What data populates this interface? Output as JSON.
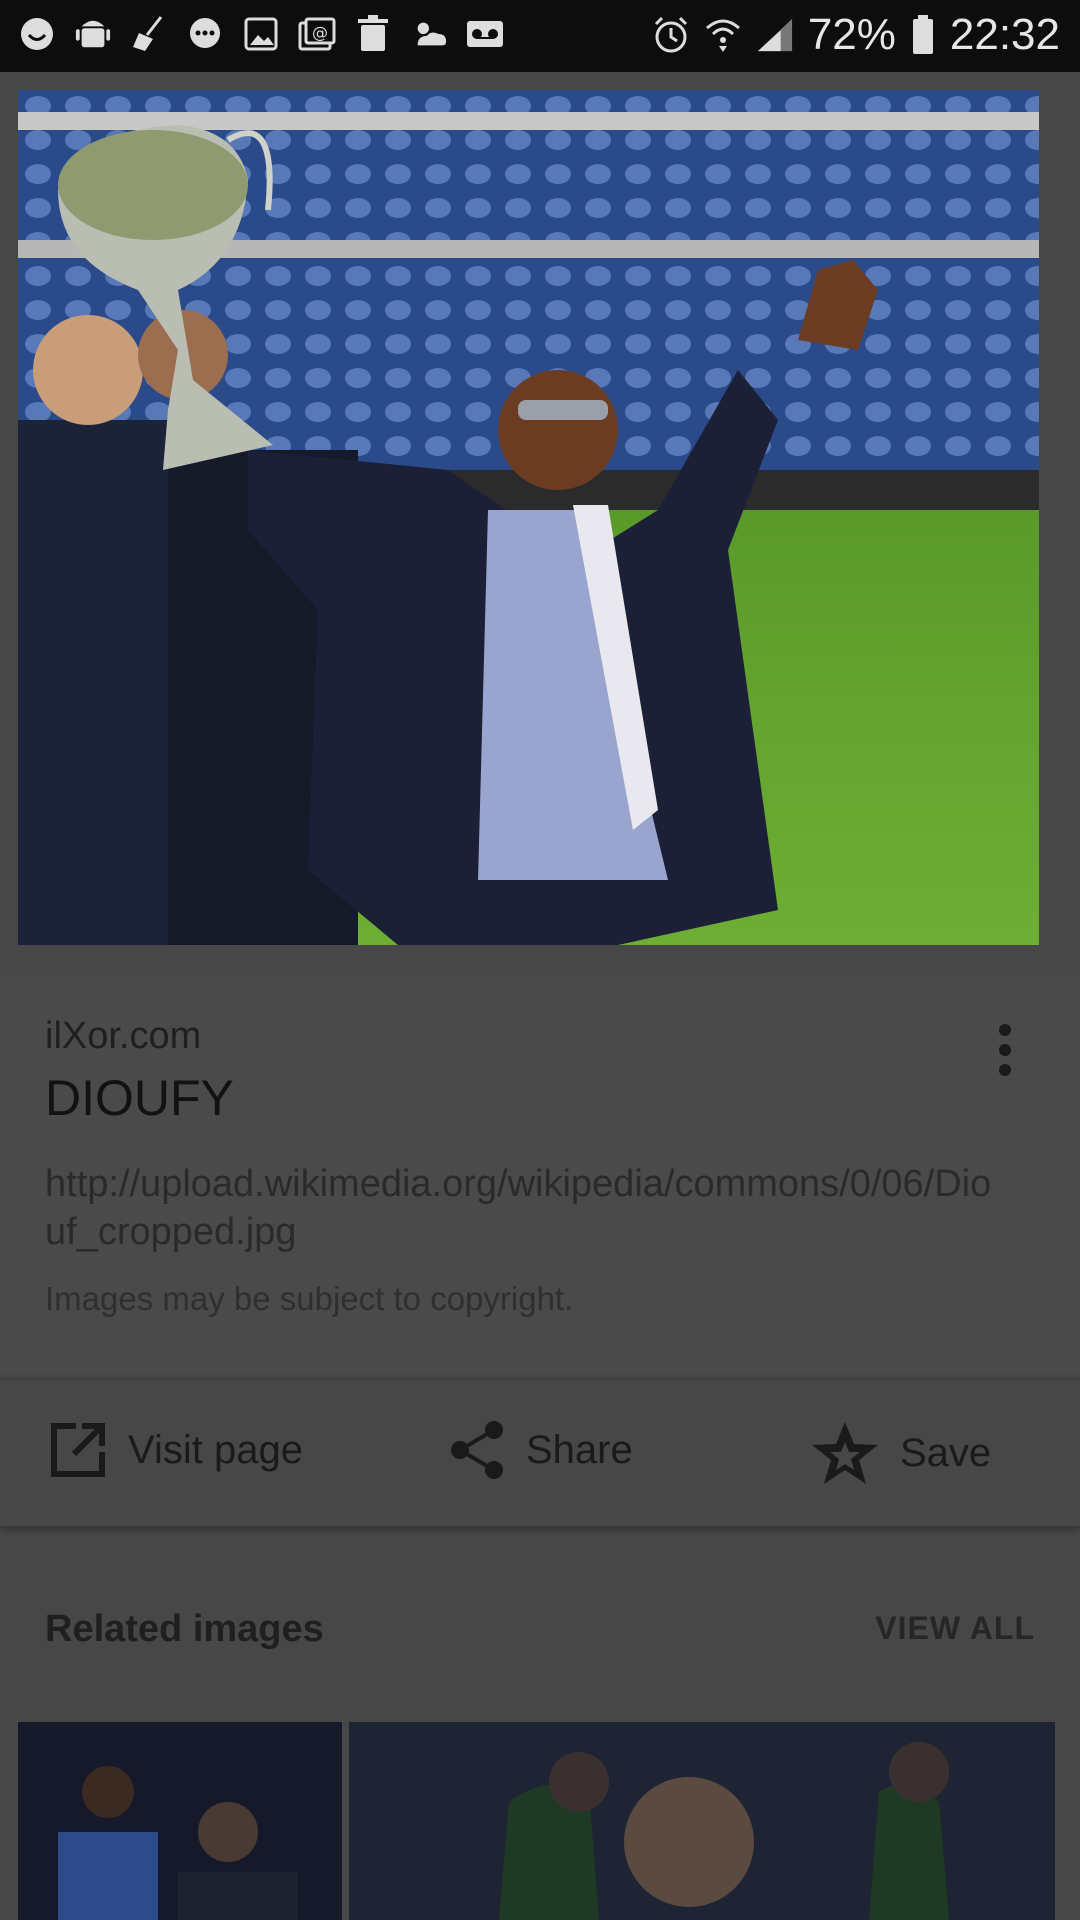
{
  "status_bar": {
    "battery_percent": "72%",
    "time": "22:32",
    "icons": [
      "smiley-icon",
      "android-icon",
      "broom-icon",
      "chat-icon",
      "image-icon",
      "email-icon",
      "trash-icon",
      "weather-icon",
      "voicemail-icon",
      "alarm-icon",
      "wifi-icon",
      "signal-icon",
      "battery-icon"
    ]
  },
  "result": {
    "source": "ilXor.com",
    "title": "DIOUFY",
    "url": "http://upload.wikimedia.org/wikipedia/commons/0/06/Diouf_cropped.jpg",
    "copyright": "Images may be subject to copyright."
  },
  "actions": {
    "visit_label": "Visit page",
    "share_label": "Share",
    "save_label": "Save"
  },
  "related": {
    "title": "Related images",
    "view_all_label": "VIEW ALL"
  }
}
